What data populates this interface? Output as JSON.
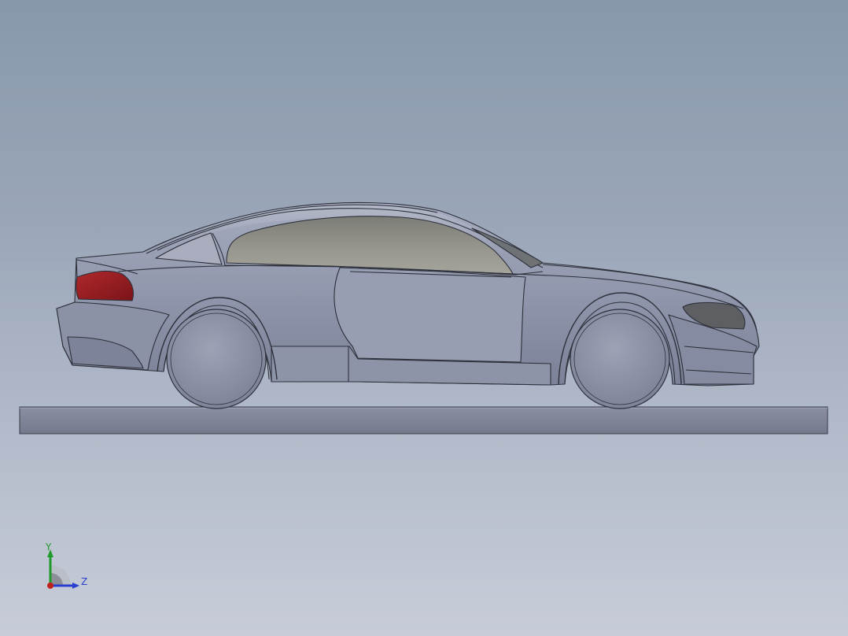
{
  "viewport": {
    "background_top": "#8898ab",
    "background_bottom": "#c7ccd8"
  },
  "model": {
    "body_color": "#9097ac",
    "glass_color": "#8e8e86",
    "taillight_color": "#9c1c22",
    "headlight_color": "#5e5f62",
    "wheel_color": "#8f94a8",
    "base_plate_color": "#7e8397"
  },
  "triad": {
    "y_label": "Y",
    "z_label": "Z",
    "y_color": "#1f9a2a",
    "z_color": "#2a3ed0",
    "x_color": "#c0201c"
  }
}
